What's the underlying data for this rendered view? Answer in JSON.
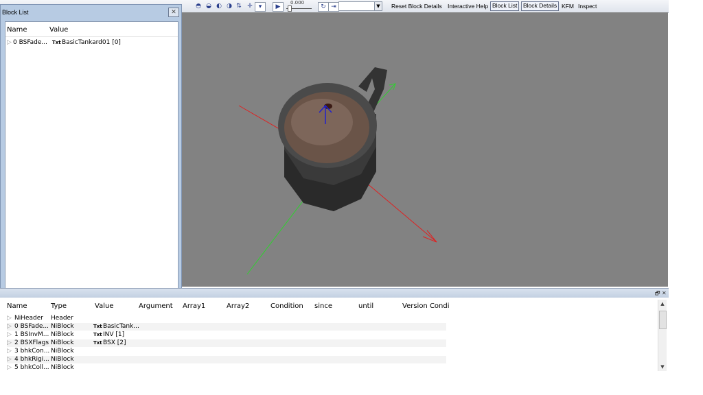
{
  "toolbar": {
    "time_value": "0.000",
    "buttons": {
      "reset_block_details": "Reset Block Details",
      "interactive_help": "Interactive Help",
      "block_list": "Block List",
      "block_details": "Block Details",
      "kfm": "KFM",
      "inspect": "Inspect"
    }
  },
  "block_list": {
    "title": "Block List",
    "columns": [
      "Name",
      "Value"
    ],
    "rows": [
      {
        "name": "0 BSFade...",
        "tag": "Txt",
        "value": "BasicTankard01 [0]"
      }
    ]
  },
  "block_details": {
    "columns": [
      "Name",
      "Type",
      "Value",
      "Argument",
      "Array1",
      "Array2",
      "Condition",
      "since",
      "until",
      "Version Condi"
    ],
    "rows": [
      {
        "name": "NiHeader",
        "type": "Header",
        "tag": "",
        "value": ""
      },
      {
        "name": "0 BSFade...",
        "type": "NiBlock",
        "tag": "Txt",
        "value": "BasicTank..."
      },
      {
        "name": "1 BSInvM...",
        "type": "NiBlock",
        "tag": "Txt",
        "value": "INV [1]"
      },
      {
        "name": "2 BSXFlags",
        "type": "NiBlock",
        "tag": "Txt",
        "value": "BSX [2]"
      },
      {
        "name": "3 bhkCon...",
        "type": "NiBlock",
        "tag": "",
        "value": ""
      },
      {
        "name": "4 bhkRigi...",
        "type": "NiBlock",
        "tag": "",
        "value": ""
      },
      {
        "name": "5 bhkColl...",
        "type": "NiBlock",
        "tag": "",
        "value": ""
      }
    ]
  },
  "colors": {
    "viewport_bg": "#828282",
    "axis_x": "#e02020",
    "axis_y": "#30d030",
    "axis_z": "#2020d0"
  }
}
